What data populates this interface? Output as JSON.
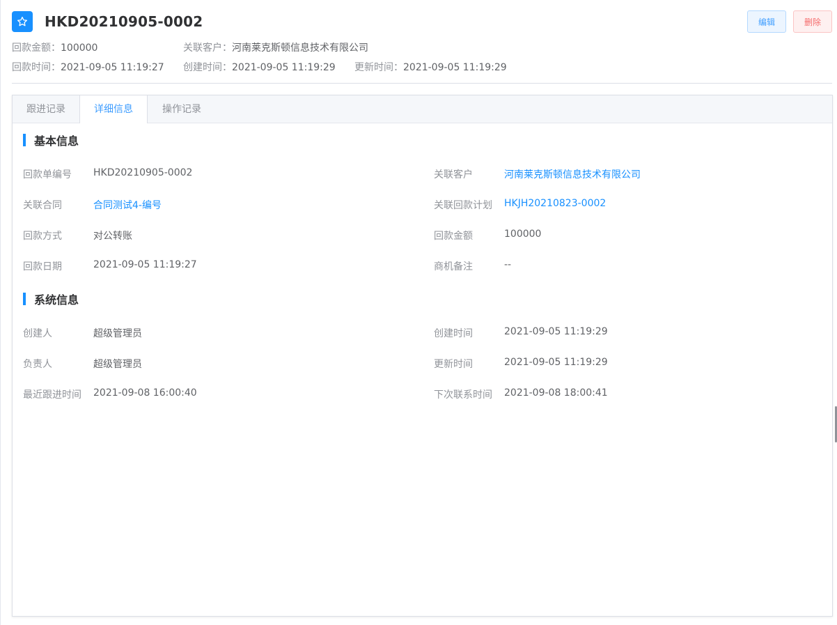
{
  "header": {
    "title": "HKD20210905-0002",
    "star_icon": "star-icon",
    "edit_label": "编辑",
    "delete_label": "删除",
    "meta": {
      "amount_label": "回款金额：",
      "amount_value": "100000",
      "customer_label": "关联客户：",
      "customer_value": "河南莱克斯顿信息技术有限公司",
      "payment_time_label": "回款时间：",
      "payment_time_value": "2021-09-05 11:19:27",
      "created_label": "创建时间：",
      "created_value": "2021-09-05 11:19:29",
      "updated_label": "更新时间：",
      "updated_value": "2021-09-05 11:19:29"
    }
  },
  "tabs": [
    {
      "label": "跟进记录",
      "active": false
    },
    {
      "label": "详细信息",
      "active": true
    },
    {
      "label": "操作记录",
      "active": false
    }
  ],
  "basic": {
    "title": "基本信息",
    "fields": {
      "receipt_no_label": "回款单编号",
      "receipt_no_value": "HKD20210905-0002",
      "customer_label": "关联客户",
      "customer_value": "河南莱克斯顿信息技术有限公司",
      "contract_label": "关联合同",
      "contract_value": "合同测试4-编号",
      "plan_label": "关联回款计划",
      "plan_value": "HKJH20210823-0002",
      "method_label": "回款方式",
      "method_value": "对公转账",
      "amount_label": "回款金额",
      "amount_value": "100000",
      "date_label": "回款日期",
      "date_value": "2021-09-05 11:19:27",
      "remark_label": "商机备注",
      "remark_value": "--"
    }
  },
  "system": {
    "title": "系统信息",
    "fields": {
      "creator_label": "创建人",
      "creator_value": "超级管理员",
      "created_label": "创建时间",
      "created_value": "2021-09-05 11:19:29",
      "owner_label": "负责人",
      "owner_value": "超级管理员",
      "updated_label": "更新时间",
      "updated_value": "2021-09-05 11:19:29",
      "last_follow_label": "最近跟进时间",
      "last_follow_value": "2021-09-08 16:00:40",
      "next_contact_label": "下次联系时间",
      "next_contact_value": "2021-09-08 18:00:41"
    }
  },
  "colors": {
    "primary": "#1890ff",
    "danger": "#f56c6c"
  }
}
